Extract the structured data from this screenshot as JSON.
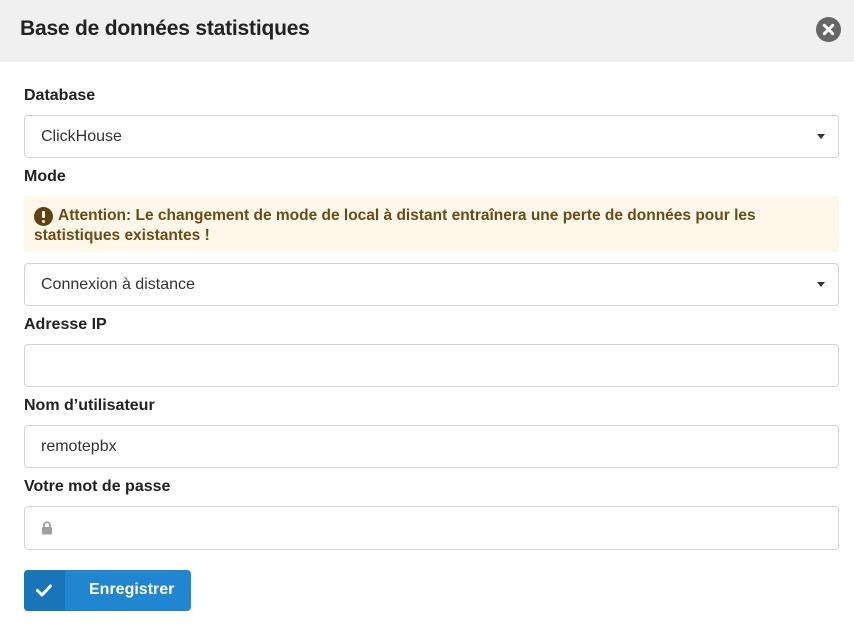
{
  "dialog": {
    "title": "Base de données statistiques",
    "close_icon": "close-circle-icon"
  },
  "database": {
    "label": "Database",
    "selected": "ClickHouse"
  },
  "mode": {
    "label": "Mode",
    "warning": "Attention: Le changement de mode de local à distant entraînera une perte de données pour les statistiques existantes !",
    "warning_icon": "exclamation-circle-icon",
    "selected": "Connexion à distance"
  },
  "ip_address": {
    "label": "Adresse IP",
    "value": ""
  },
  "username": {
    "label": "Nom d’utilisateur",
    "value": "remotepbx"
  },
  "password": {
    "label": "Votre mot de passe",
    "value": "",
    "icon": "lock-icon"
  },
  "save_button": {
    "label": "Enregistrer",
    "icon": "checkmark-icon",
    "color": "#2185d0"
  },
  "colors": {
    "header_bg": "#f0f0f0",
    "warning_bg": "#fff8ea",
    "warning_text": "#6b4a16"
  }
}
